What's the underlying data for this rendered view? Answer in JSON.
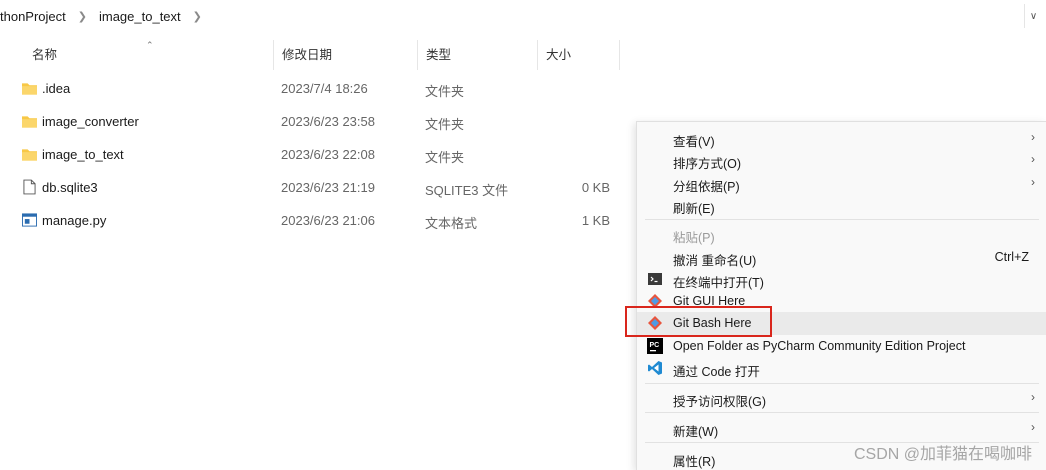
{
  "breadcrumb": {
    "items": [
      "thonProject",
      "image_to_text"
    ]
  },
  "columns": {
    "name": "名称",
    "modified": "修改日期",
    "type": "类型",
    "size": "大小"
  },
  "files": [
    {
      "name": ".idea",
      "modified": "2023/7/4 18:26",
      "type": "文件夹",
      "size": "",
      "icon": "folder-icon"
    },
    {
      "name": "image_converter",
      "modified": "2023/6/23 23:58",
      "type": "文件夹",
      "size": "",
      "icon": "folder-icon"
    },
    {
      "name": "image_to_text",
      "modified": "2023/6/23 22:08",
      "type": "文件夹",
      "size": "",
      "icon": "folder-icon"
    },
    {
      "name": "db.sqlite3",
      "modified": "2023/6/23 21:19",
      "type": "SQLITE3 文件",
      "size": "0 KB",
      "icon": "file-icon"
    },
    {
      "name": "manage.py",
      "modified": "2023/6/23 21:06",
      "type": "文本格式",
      "size": "1 KB",
      "icon": "python-file-icon"
    }
  ],
  "context_menu": {
    "items": [
      {
        "label": "查看(V)",
        "submenu": true
      },
      {
        "label": "排序方式(O)",
        "submenu": true
      },
      {
        "label": "分组依据(P)",
        "submenu": true
      },
      {
        "label": "刷新(E)"
      },
      {
        "label": "粘贴(P)",
        "disabled": true
      },
      {
        "label": "撤消 重命名(U)",
        "shortcut": "Ctrl+Z"
      },
      {
        "label": "在终端中打开(T)",
        "icon": "terminal-icon"
      },
      {
        "label": "Git GUI Here",
        "icon": "git-icon"
      },
      {
        "label": "Git Bash Here",
        "icon": "git-icon"
      },
      {
        "label": "Open Folder as PyCharm Community Edition Project",
        "icon": "pycharm-icon"
      },
      {
        "label": "通过 Code 打开",
        "icon": "vscode-icon"
      },
      {
        "label": "授予访问权限(G)",
        "submenu": true
      },
      {
        "label": "新建(W)",
        "submenu": true
      },
      {
        "label": "属性(R)"
      }
    ]
  },
  "watermark": "CSDN @加菲猫在喝咖啡",
  "colors": {
    "folder": "#f8c846",
    "highlight_box": "#d9261c",
    "git": "#e8553e",
    "vscode": "#1f8ad2"
  }
}
